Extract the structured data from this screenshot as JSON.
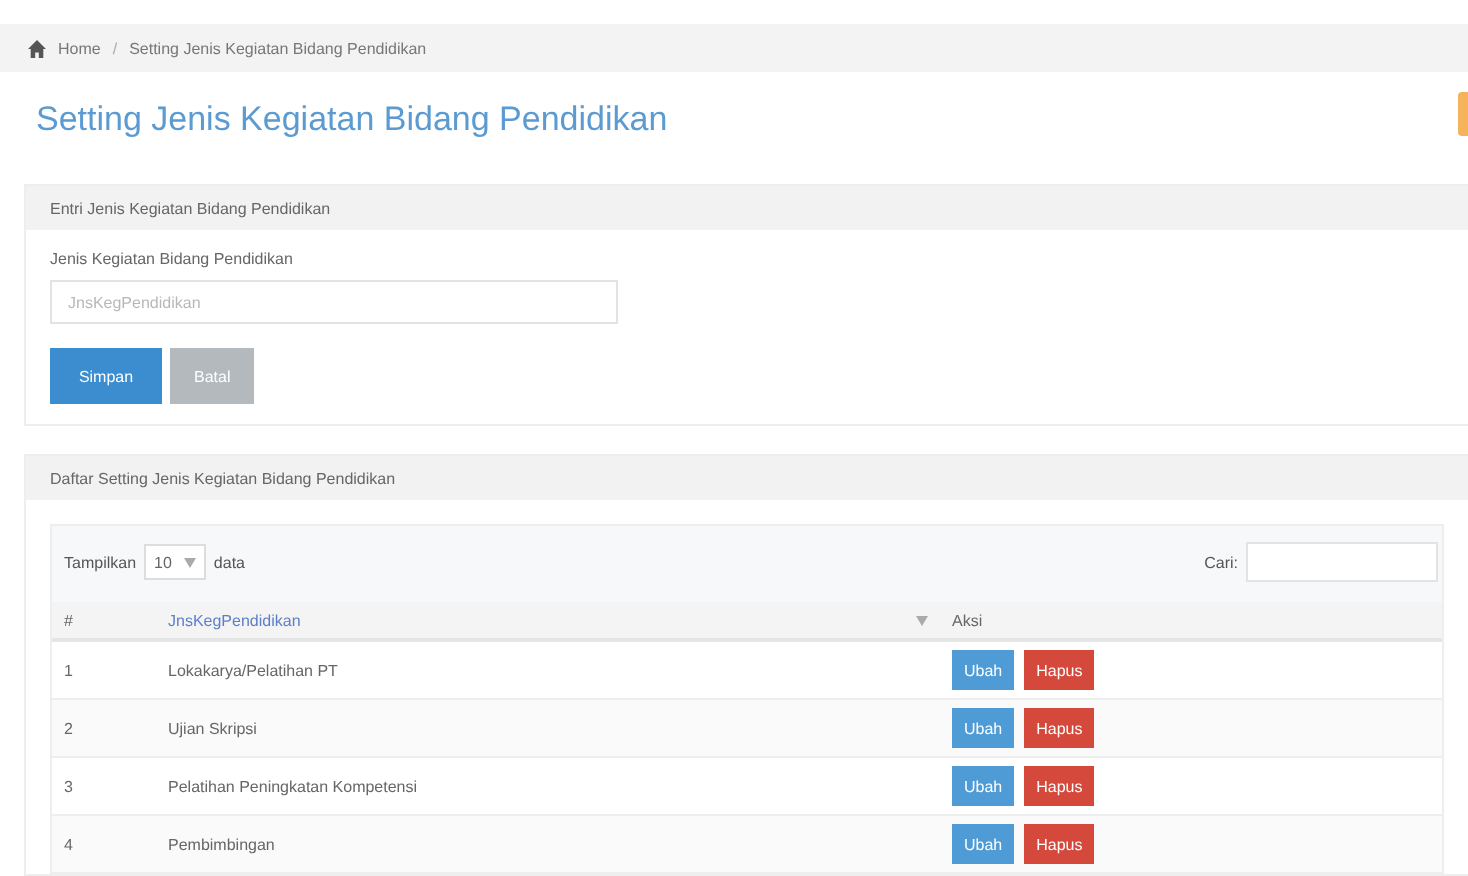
{
  "breadcrumb": {
    "separator": "/",
    "items": [
      "Home",
      "Setting Jenis Kegiatan Bidang Pendidikan"
    ]
  },
  "page_title": "Setting Jenis Kegiatan Bidang Pendidikan",
  "form_panel": {
    "title": "Entri Jenis Kegiatan Bidang Pendidikan",
    "label": "Jenis Kegiatan Bidang Pendidikan",
    "placeholder": "JnsKegPendidikan",
    "buttons": [
      {
        "label": "Simpan",
        "kind": "primary"
      },
      {
        "label": "Batal",
        "kind": "default"
      }
    ]
  },
  "list_panel": {
    "title": "Daftar Setting Jenis Kegiatan Bidang Pendidikan",
    "show_label": "Tampilkan",
    "page_size": "10",
    "show_suffix": "data",
    "search_label": "Cari:",
    "table": {
      "columns": [
        "#",
        "JnsKegPendidikan",
        "Aksi"
      ],
      "rows": [
        {
          "no": "1",
          "name": "Lokakarya/Pelatihan PT",
          "actions": [
            "Ubah",
            "Hapus"
          ]
        },
        {
          "no": "2",
          "name": "Ujian Skripsi",
          "actions": [
            "Ubah",
            "Hapus"
          ]
        },
        {
          "no": "3",
          "name": "Pelatihan Peningkatan Kompetensi",
          "actions": [
            "Ubah",
            "Hapus"
          ]
        },
        {
          "no": "4",
          "name": "Pembimbingan",
          "actions": [
            "Ubah",
            "Hapus"
          ]
        }
      ]
    }
  }
}
